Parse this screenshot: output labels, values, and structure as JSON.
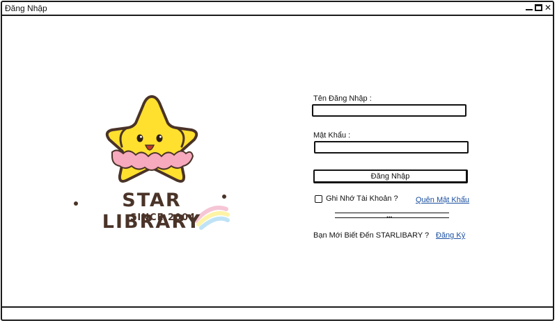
{
  "window": {
    "title": "Đăng Nhập",
    "controls": {
      "minimize": "minimize",
      "maximize": "maximize",
      "close": "✕"
    }
  },
  "logo": {
    "brand": "STAR LIBRARY",
    "since": "SINCE 2004",
    "colors": {
      "star": "#ffe02e",
      "outline": "#4a3328",
      "skirt": "#f7a9bd",
      "rainbow_1": "#f6c6d6",
      "rainbow_2": "#fff3a6",
      "rainbow_3": "#bfe3f5"
    }
  },
  "form": {
    "username_label": "Tên Đăng Nhập :",
    "username_value": "",
    "password_label": "Mật Khẩu :",
    "password_value": "",
    "login_button": "Đăng Nhập",
    "remember_label": "Ghi Nhớ Tài Khoản ?",
    "remember_checked": false,
    "forgot_link": "Quên Mật Khẩu",
    "divider_text": "...",
    "signup_prompt": "Bạn Mới Biết Đến STARLIBARY ?",
    "signup_link": "Đăng Ký"
  },
  "colors": {
    "link": "#1a4fa0",
    "border": "#1a1a1a"
  }
}
